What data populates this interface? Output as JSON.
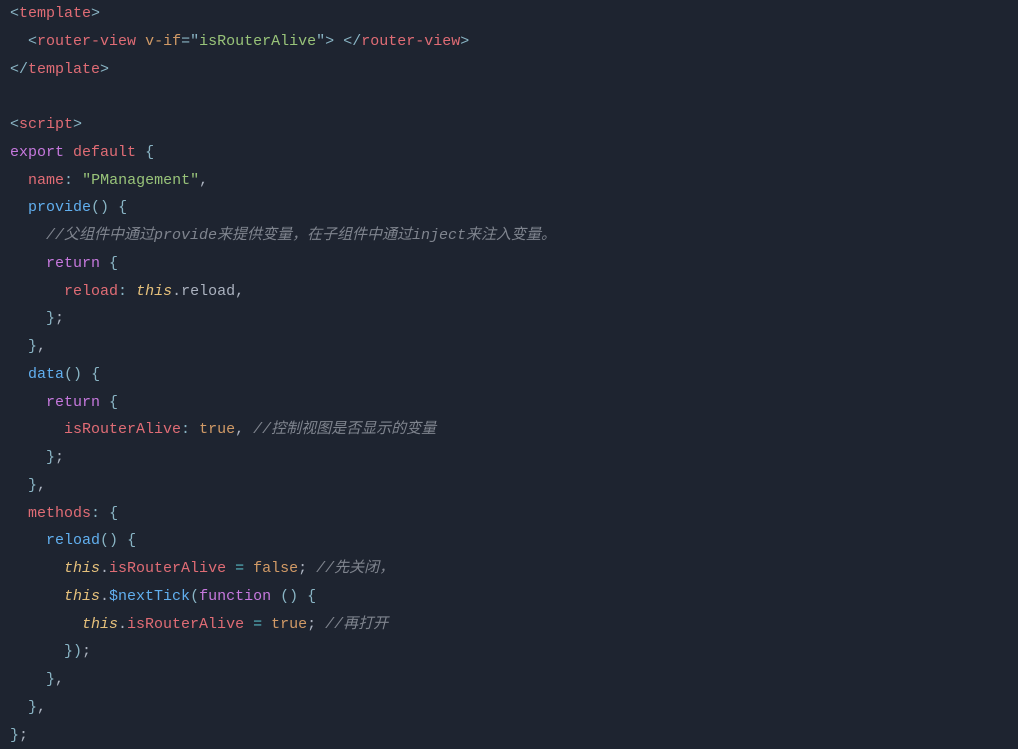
{
  "code": {
    "line1": {
      "p1": "<",
      "tag": "template",
      "p2": ">"
    },
    "line2": {
      "indent": "  ",
      "p1": "<",
      "tag": "router-view",
      "sp": " ",
      "attr": "v-if",
      "eq": "=",
      "q1": "\"",
      "val": "isRouterAlive",
      "q2": "\"",
      "p2": ">",
      "sp2": " ",
      "p3": "</",
      "tag2": "router-view",
      "p4": ">"
    },
    "line3": {
      "p1": "</",
      "tag": "template",
      "p2": ">"
    },
    "line4": "",
    "line5": {
      "p1": "<",
      "tag": "script",
      "p2": ">"
    },
    "line6": {
      "kw1": "export",
      "sp": " ",
      "kw2": "default",
      "sp2": " ",
      "brace": "{"
    },
    "line7": {
      "indent": "  ",
      "prop": "name",
      "colon": ":",
      "sp": " ",
      "str": "\"PManagement\"",
      "comma": ","
    },
    "line8": {
      "indent": "  ",
      "func": "provide",
      "paren": "()",
      "sp": " ",
      "brace": "{"
    },
    "line9": {
      "indent": "    ",
      "comment": "//父组件中通过provide来提供变量，在子组件中通过inject来注入变量。"
    },
    "line10": {
      "indent": "    ",
      "kw": "return",
      "sp": " ",
      "brace": "{"
    },
    "line11": {
      "indent": "      ",
      "prop": "reload",
      "colon": ":",
      "sp": " ",
      "this": "this",
      "dot": ".",
      "member": "reload",
      "comma": ","
    },
    "line12": {
      "indent": "    ",
      "brace": "}",
      "semi": ";"
    },
    "line13": {
      "indent": "  ",
      "brace": "}",
      "comma": ","
    },
    "line14": {
      "indent": "  ",
      "func": "data",
      "paren": "()",
      "sp": " ",
      "brace": "{"
    },
    "line15": {
      "indent": "    ",
      "kw": "return",
      "sp": " ",
      "brace": "{"
    },
    "line16": {
      "indent": "      ",
      "prop": "isRouterAlive",
      "colon": ":",
      "sp": " ",
      "bool": "true",
      "comma": ",",
      "sp2": " ",
      "comment": "//控制视图是否显示的变量"
    },
    "line17": {
      "indent": "    ",
      "brace": "}",
      "semi": ";"
    },
    "line18": {
      "indent": "  ",
      "brace": "}",
      "comma": ","
    },
    "line19": {
      "indent": "  ",
      "prop": "methods",
      "colon": ":",
      "sp": " ",
      "brace": "{"
    },
    "line20": {
      "indent": "    ",
      "func": "reload",
      "paren": "()",
      "sp": " ",
      "brace": "{"
    },
    "line21": {
      "indent": "      ",
      "this": "this",
      "dot": ".",
      "member": "isRouterAlive",
      "sp": " ",
      "op": "=",
      "sp2": " ",
      "bool": "false",
      "semi": ";",
      "sp3": " ",
      "comment": "//先关闭，"
    },
    "line22": {
      "indent": "      ",
      "this": "this",
      "dot": ".",
      "func": "$nextTick",
      "paren1": "(",
      "kw": "function",
      "sp": " ",
      "paren2": "()",
      "sp2": " ",
      "brace": "{"
    },
    "line23": {
      "indent": "        ",
      "this": "this",
      "dot": ".",
      "member": "isRouterAlive",
      "sp": " ",
      "op": "=",
      "sp2": " ",
      "bool": "true",
      "semi": ";",
      "sp3": " ",
      "comment": "//再打开"
    },
    "line24": {
      "indent": "      ",
      "brace": "})",
      "semi": ";"
    },
    "line25": {
      "indent": "    ",
      "brace": "}",
      "comma": ","
    },
    "line26": {
      "indent": "  ",
      "brace": "}",
      "comma": ","
    },
    "line27": {
      "brace": "}",
      "semi": ";"
    }
  }
}
